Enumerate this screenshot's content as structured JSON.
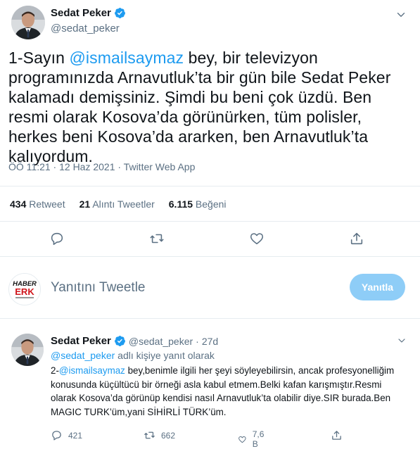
{
  "main_tweet": {
    "author_name": "Sedat Peker",
    "author_handle": "@sedat_peker",
    "text_number": "1-Sayın ",
    "text_mention": "@ismailsaymaz",
    "text_body": "  bey, bir televizyon programınızda Arnavutluk’ta bir gün bile Sedat Peker kalamadı demişsiniz. Şimdi bu beni çok üzdü. Ben resmi olarak Kosova’da görünürken, tüm polisler, herkes beni Kosova’da ararken, ben Arnavutluk’ta kalıyordum.",
    "meta": "ÖÖ 11:21 · 12 Haz 2021 · Twitter Web App"
  },
  "stats": {
    "retweets_count": "434",
    "retweets_label": "Retweet",
    "quotes_count": "21",
    "quotes_label": "Alıntı Tweetler",
    "likes_count": "6.115",
    "likes_label": "Beğeni"
  },
  "composer": {
    "avatar_text_top": "HABER",
    "avatar_text_bottom": "ERK",
    "placeholder": "Yanıtını Tweetle",
    "button_label": "Yanıtla"
  },
  "reply_tweet": {
    "author_name": "Sedat Peker",
    "author_handle": "@sedat_peker",
    "separator": "·",
    "time": "27d",
    "reply_to_mention": "@sedat_peker",
    "reply_to_text": " adlı kişiye yanıt olarak",
    "text_number": "2-",
    "text_mention": "@ismailsaymaz",
    "text_body": " bey,benimle ilgili her şeyi söyleyebilirsin, ancak profesyonelliğim konusunda küçültücü bir örneği asla kabul etmem.Belki kafan karışmıştır.Resmi olarak Kosova’da görünüp kendisi nasıl Arnavutluk’ta olabilir diye.SIR burada.Ben MAGIC TURK’üm,yani SİHİRLİ TÜRK’üm.",
    "replies": "421",
    "retweets": "662",
    "likes": "7,6 B"
  },
  "colors": {
    "accent": "#1d9bf0",
    "muted": "#5b7083",
    "reply_button": "#8ecdf7",
    "verified": "#1d9bf0"
  },
  "icons": [
    "verified-badge-icon",
    "chevron-down-icon",
    "reply-icon",
    "retweet-icon",
    "like-icon",
    "share-icon"
  ]
}
